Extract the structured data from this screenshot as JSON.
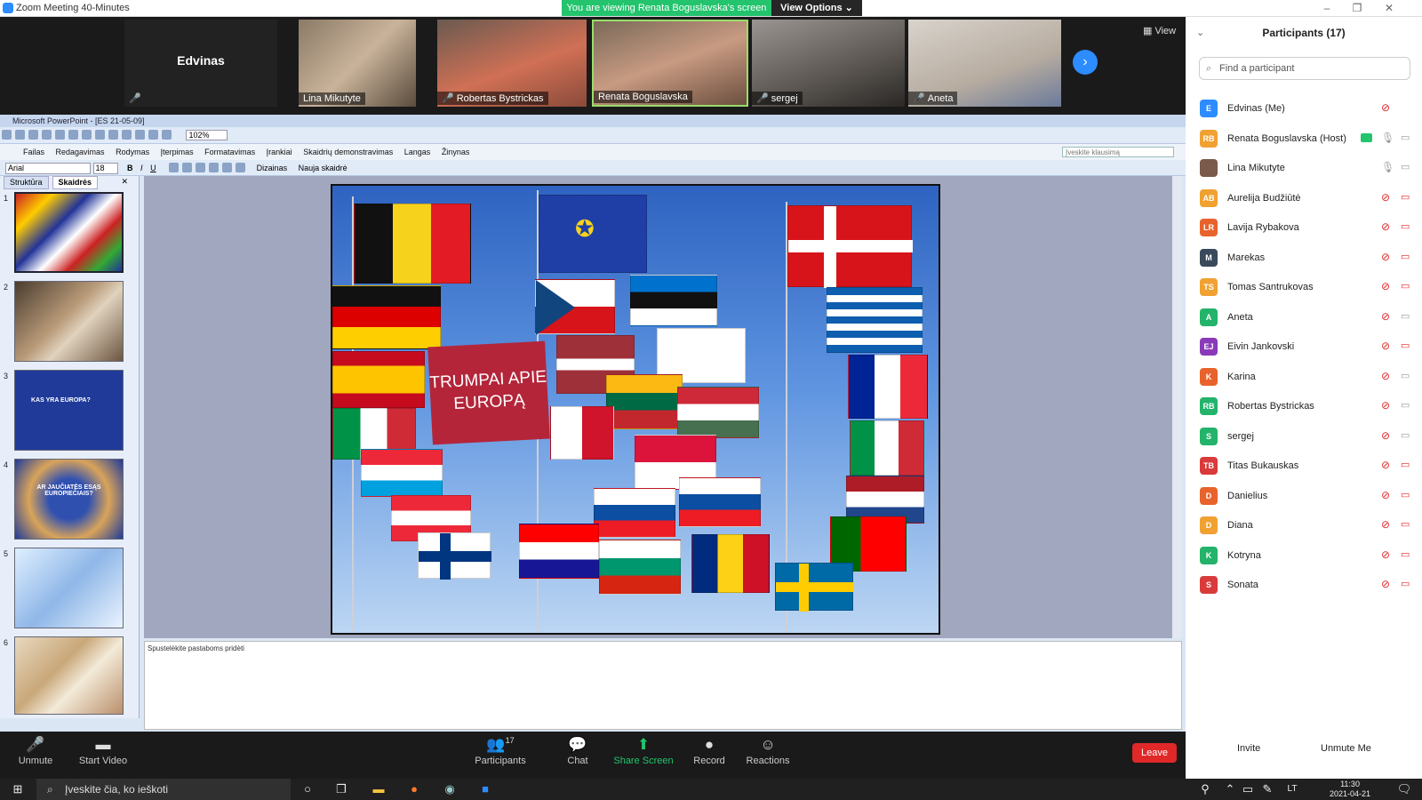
{
  "window": {
    "title": "Zoom Meeting 40-Minutes",
    "share_banner": "You are viewing Renata Boguslavska's screen",
    "view_options": "View Options ⌄"
  },
  "gallery": {
    "view_label": "View",
    "tiles": [
      {
        "name": "Edvinas"
      },
      {
        "name": "Lina Mikutyte"
      },
      {
        "name": "Robertas Bystrickas"
      },
      {
        "name": "Renata Boguslavska"
      },
      {
        "name": "sergej"
      },
      {
        "name": "Aneta"
      }
    ]
  },
  "ppt": {
    "title": "Microsoft PowerPoint - [ES 21-05-09]",
    "zoom": "102%",
    "menu": [
      "Failas",
      "Redagavimas",
      "Rodymas",
      "Įterpimas",
      "Formatavimas",
      "Įrankiai",
      "Skaidrių demonstravimas",
      "Langas",
      "Žinynas"
    ],
    "ask": "Įveskite klausimą",
    "font": "Arial",
    "size": "18",
    "design": "Dizainas",
    "new_slide": "Nauja skaidrė",
    "tabs": [
      "Struktūra",
      "Skaidrės"
    ],
    "slides": [
      "1",
      "2",
      "3",
      "4",
      "5",
      "6"
    ],
    "slide3_text": "KAS YRA EUROPA?",
    "slide4_text": "AR JAUČIATĖS ESĄS EUROPIEČIAIS?",
    "slide_title": "TRUMPAI APIE EUROPĄ",
    "notes": "Spustelėkite pastaboms pridėti"
  },
  "toolbar": {
    "unmute": "Unmute",
    "start_video": "Start Video",
    "participants": "Participants",
    "participants_count": "17",
    "chat": "Chat",
    "share": "Share Screen",
    "record": "Record",
    "reactions": "Reactions",
    "leave": "Leave"
  },
  "participants": {
    "header": "Participants (17)",
    "search_placeholder": "Find a participant",
    "list": [
      {
        "initials": "E",
        "name": "Edvinas (Me)",
        "color": "#2d8cff"
      },
      {
        "initials": "RB",
        "name": "Renata Boguslavska (Host)",
        "color": "#f0a132"
      },
      {
        "initials": "",
        "name": "Lina Mikutyte",
        "color": "#7a5a4a"
      },
      {
        "initials": "AB",
        "name": "Aurelija Budžiūtė",
        "color": "#f0a132"
      },
      {
        "initials": "LR",
        "name": "Lavija Rybakova",
        "color": "#e8632c"
      },
      {
        "initials": "M",
        "name": "Marekas",
        "color": "#3a4a5c"
      },
      {
        "initials": "TS",
        "name": "Tomas Santrukovas",
        "color": "#f0a132"
      },
      {
        "initials": "A",
        "name": "Aneta",
        "color": "#23b36b"
      },
      {
        "initials": "EJ",
        "name": "Eivin Jankovski",
        "color": "#8a3ab9"
      },
      {
        "initials": "K",
        "name": "Karina",
        "color": "#e8632c"
      },
      {
        "initials": "RB",
        "name": "Robertas Bystrickas",
        "color": "#23b36b"
      },
      {
        "initials": "S",
        "name": "sergej",
        "color": "#23b36b"
      },
      {
        "initials": "TB",
        "name": "Titas Bukauskas",
        "color": "#d93a3a"
      },
      {
        "initials": "D",
        "name": "Danielius",
        "color": "#e8632c"
      },
      {
        "initials": "D",
        "name": "Diana",
        "color": "#f0a132"
      },
      {
        "initials": "K",
        "name": "Kotryna",
        "color": "#23b36b"
      },
      {
        "initials": "S",
        "name": "Sonata",
        "color": "#d93a3a"
      }
    ],
    "invite": "Invite",
    "unmute_me": "Unmute Me"
  },
  "taskbar": {
    "search": "Įveskite čia, ko ieškoti",
    "lang": "LT",
    "time": "11:30",
    "date": "2021-04-21"
  }
}
